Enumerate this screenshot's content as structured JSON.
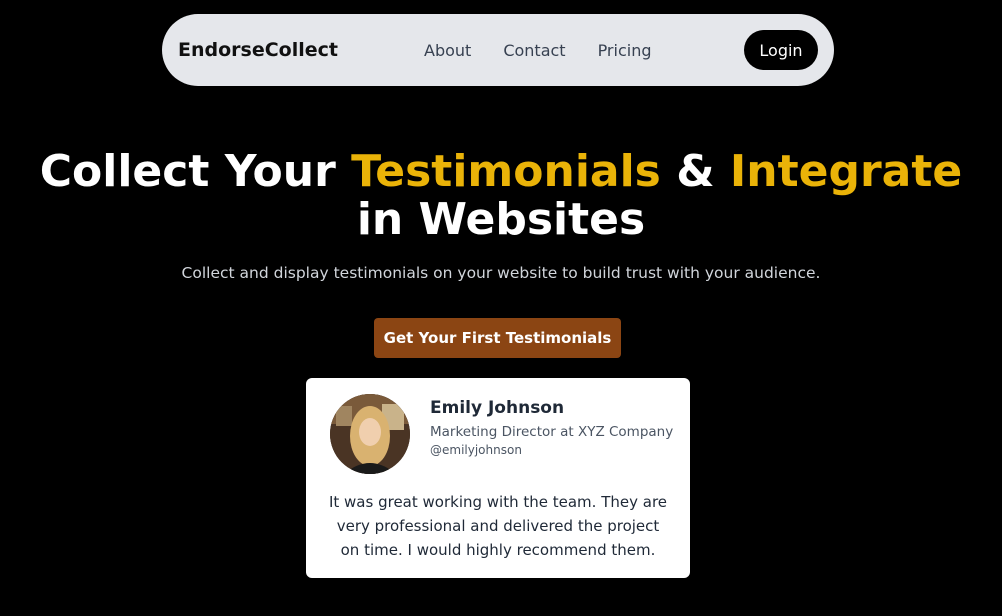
{
  "navbar": {
    "brand": "EndorseCollect",
    "links": [
      {
        "label": "About"
      },
      {
        "label": "Contact"
      },
      {
        "label": "Pricing"
      }
    ],
    "login_label": "Login"
  },
  "hero": {
    "title_part1": "Collect Your ",
    "title_highlight1": "Testimonials",
    "title_part2": " & ",
    "title_highlight2": "Integrate",
    "title_part3": "in Websites",
    "subtitle": "Collect and display testimonials on your website to build trust with your audience.",
    "cta_label": "Get Your First Testimonials",
    "highlight_color": "#eab308",
    "cta_color": "#8b4513"
  },
  "testimonial": {
    "name": "Emily Johnson",
    "role": "Marketing Director at XYZ Company",
    "handle": "@emilyjohnson",
    "text": "It was great working with the team. They are very professional and delivered the project on time. I would highly recommend them."
  }
}
